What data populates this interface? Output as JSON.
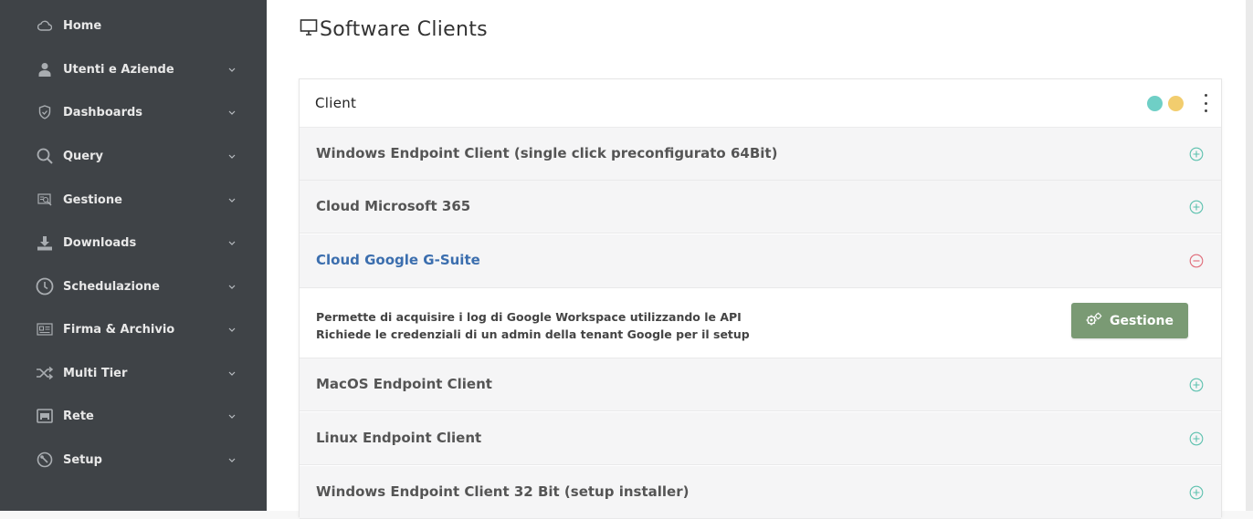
{
  "sidebar": {
    "items": [
      {
        "label": "Home",
        "icon": "cloud-icon",
        "has_chevron": false
      },
      {
        "label": "Utenti e Aziende",
        "icon": "user-icon",
        "has_chevron": true
      },
      {
        "label": "Dashboards",
        "icon": "shield-icon",
        "has_chevron": true
      },
      {
        "label": "Query",
        "icon": "search-icon",
        "has_chevron": true
      },
      {
        "label": "Gestione",
        "icon": "zoom-report-icon",
        "has_chevron": true
      },
      {
        "label": "Downloads",
        "icon": "download-icon",
        "has_chevron": true
      },
      {
        "label": "Schedulazione",
        "icon": "clock-icon",
        "has_chevron": true
      },
      {
        "label": "Firma & Archivio",
        "icon": "archive-icon",
        "has_chevron": true
      },
      {
        "label": "Multi Tier",
        "icon": "shuffle-icon",
        "has_chevron": true
      },
      {
        "label": "Rete",
        "icon": "network-port-icon",
        "has_chevron": true
      },
      {
        "label": "Setup",
        "icon": "setup-icon",
        "has_chevron": true
      }
    ]
  },
  "page": {
    "title": "Software Clients",
    "title_icon": "monitor-icon"
  },
  "card": {
    "header_title": "Client",
    "colors": {
      "dot_teal": "#6fcfc6",
      "dot_yellow": "#f2cd6e"
    },
    "rows": [
      {
        "title": "Windows Endpoint Client (single click preconfigurato 64Bit)",
        "expanded": false
      },
      {
        "title": "Cloud Microsoft 365",
        "expanded": false
      },
      {
        "title": "Cloud Google G-Suite",
        "expanded": true
      },
      {
        "title": "MacOS Endpoint Client",
        "expanded": false
      },
      {
        "title": "Linux Endpoint Client",
        "expanded": false
      },
      {
        "title": "Windows Endpoint Client 32 Bit (setup installer)",
        "expanded": false
      }
    ],
    "expanded_body": {
      "line1": "Permette di acquisire i log di Google Workspace utilizzando le API",
      "line2": "Richiede le credenziali di un admin della tenant Google per il setup",
      "button_label": "Gestione"
    }
  },
  "colors": {
    "sidebar_bg": "#3f4347",
    "accent_blue": "#3b6eae",
    "plus_green": "#5cc1ae",
    "minus_red": "#e06a78",
    "button_green": "#7a9a74"
  }
}
